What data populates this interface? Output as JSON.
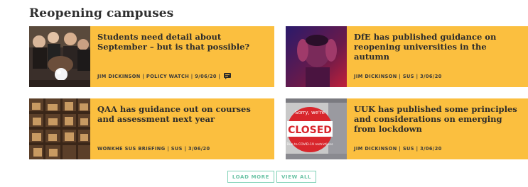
{
  "section": {
    "title": "Reopening campuses"
  },
  "articles": [
    {
      "headline": "Students need detail about September – but is that possible?",
      "byline": "JIM DICKINSON | POLICY WATCH | 9/06/20 |",
      "image": "fortune-teller-crystal-ball-photo",
      "has_comment_icon": true
    },
    {
      "headline": "DfE has published guidance on reopening universities in the autumn",
      "byline": "JIM DICKINSON | SUS | 3/06/20",
      "image": "stressed-person-head-in-hands-photo"
    },
    {
      "headline": "QAA has guidance out on courses and assessment next year",
      "byline": "WONKHE SUS BRIEFING | SUS | 3/06/20",
      "image": "library-shelves-photo"
    },
    {
      "headline": "UUK has published some principles and considerations on emerging from lockdown",
      "byline": "JIM DICKINSON | SUS | 3/06/20",
      "image": "closed-sign-photo",
      "image_text": {
        "small": "Sorry, we're",
        "big": "CLOSED",
        "note": "Due to COVID-19 restrictions"
      }
    }
  ],
  "buttons": {
    "load_more": "LOAD MORE",
    "view_all": "VIEW ALL"
  },
  "colors": {
    "card_bg": "#fbbf3f",
    "button_accent": "#7fd1b6",
    "title_text": "#2f2f2f"
  }
}
